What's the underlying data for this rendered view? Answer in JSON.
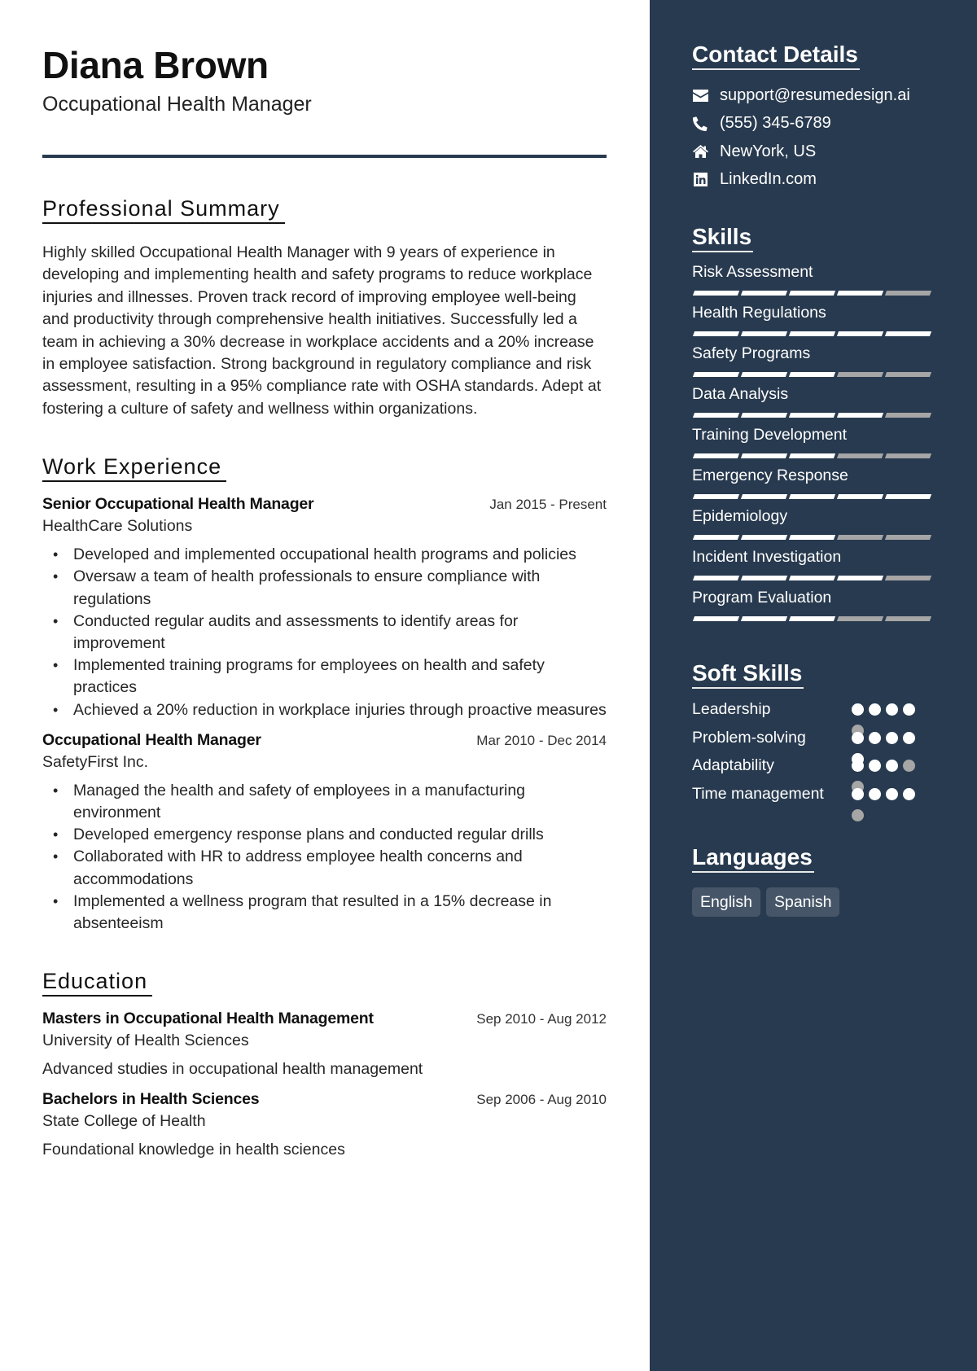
{
  "header": {
    "name": "Diana Brown",
    "title": "Occupational Health Manager"
  },
  "colors": {
    "sidebar_bg": "#283a4f",
    "accent_rule": "#283a4f",
    "filled": "#ffffff",
    "empty": "#a6a6a6",
    "language_chip": "#465668"
  },
  "summary": {
    "heading": "Professional Summary",
    "text": "Highly skilled Occupational Health Manager with 9 years of experience in developing and implementing health and safety programs to reduce workplace injuries and illnesses. Proven track record of improving employee well-being and productivity through comprehensive health initiatives. Successfully led a team in achieving a 30% decrease in workplace accidents and a 20% increase in employee satisfaction. Strong background in regulatory compliance and risk assessment, resulting in a 95% compliance rate with OSHA standards. Adept at fostering a culture of safety and wellness within organizations."
  },
  "experience": {
    "heading": "Work Experience",
    "jobs": [
      {
        "title": "Senior Occupational Health Manager",
        "dates": "Jan 2015 - Present",
        "company": "HealthCare Solutions",
        "bullets": [
          "Developed and implemented occupational health programs and policies",
          "Oversaw a team of health professionals to ensure compliance with regulations",
          "Conducted regular audits and assessments to identify areas for improvement",
          "Implemented training programs for employees on health and safety practices",
          "Achieved a 20% reduction in workplace injuries through proactive measures"
        ]
      },
      {
        "title": "Occupational Health Manager",
        "dates": "Mar 2010 - Dec 2014",
        "company": "SafetyFirst Inc.",
        "bullets": [
          "Managed the health and safety of employees in a manufacturing environment",
          "Developed emergency response plans and conducted regular drills",
          "Collaborated with HR to address employee health concerns and accommodations",
          "Implemented a wellness program that resulted in a 15% decrease in absenteeism"
        ]
      }
    ]
  },
  "education": {
    "heading": "Education",
    "items": [
      {
        "degree": "Masters in Occupational Health Management",
        "dates": "Sep 2010 - Aug 2012",
        "school": "University of Health Sciences",
        "description": "Advanced studies in occupational health management"
      },
      {
        "degree": "Bachelors in Health Sciences",
        "dates": "Sep 2006 - Aug 2010",
        "school": "State College of Health",
        "description": "Foundational knowledge in health sciences"
      }
    ]
  },
  "contact": {
    "heading": "Contact Details",
    "items": [
      {
        "icon": "envelope-icon",
        "text": "support@resumedesign.ai"
      },
      {
        "icon": "phone-icon",
        "text": "(555) 345-6789"
      },
      {
        "icon": "home-icon",
        "text": "NewYork, US"
      },
      {
        "icon": "linkedin-icon",
        "text": "LinkedIn.com"
      }
    ]
  },
  "skills": {
    "heading": "Skills",
    "max": 5,
    "items": [
      {
        "name": "Risk Assessment",
        "level": 4
      },
      {
        "name": "Health Regulations",
        "level": 5
      },
      {
        "name": "Safety Programs",
        "level": 3
      },
      {
        "name": "Data Analysis",
        "level": 4
      },
      {
        "name": "Training Development",
        "level": 3
      },
      {
        "name": "Emergency Response",
        "level": 5
      },
      {
        "name": "Epidemiology",
        "level": 3
      },
      {
        "name": "Incident Investigation",
        "level": 4
      },
      {
        "name": "Program Evaluation",
        "level": 3
      }
    ]
  },
  "soft_skills": {
    "heading": "Soft Skills",
    "max": 5,
    "items": [
      {
        "name": "Leadership",
        "level": 4
      },
      {
        "name": "Problem-solving",
        "level": 5
      },
      {
        "name": "Adaptability",
        "level": 3
      },
      {
        "name": "Time management",
        "level": 4
      }
    ]
  },
  "languages": {
    "heading": "Languages",
    "items": [
      "English",
      "Spanish"
    ]
  }
}
